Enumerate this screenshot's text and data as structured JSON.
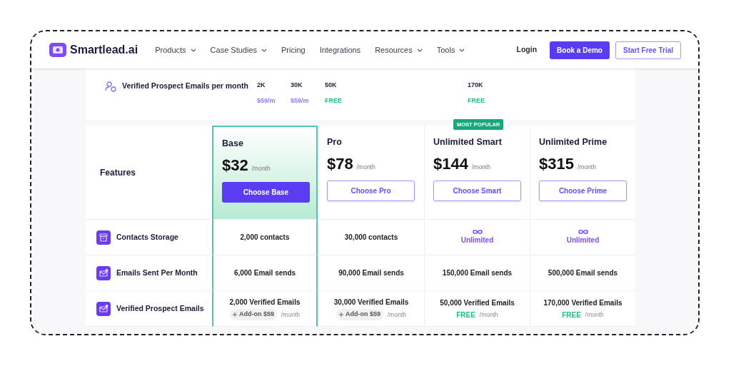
{
  "brand": {
    "name": "Smartlead.ai"
  },
  "nav": [
    {
      "label": "Products",
      "has_menu": true
    },
    {
      "label": "Case Studies",
      "has_menu": true
    },
    {
      "label": "Pricing",
      "has_menu": false
    },
    {
      "label": "Integrations",
      "has_menu": false
    },
    {
      "label": "Resources",
      "has_menu": true
    },
    {
      "label": "Tools",
      "has_menu": true
    }
  ],
  "nav_actions": [
    {
      "label": "Login",
      "kind": "link"
    },
    {
      "label": "Book a Demo",
      "kind": "primary"
    },
    {
      "label": "Start Free Trial",
      "kind": "outline"
    }
  ],
  "prospect_row": {
    "label": "Verified Prospect Emails per month",
    "values": [
      {
        "amount": "2K",
        "price": "$59/m",
        "kind": "paid"
      },
      {
        "amount": "30K",
        "price": "$59/m",
        "kind": "paid"
      },
      {
        "amount": "50K",
        "price": "FREE",
        "kind": "free"
      },
      {
        "amount": "170K",
        "price": "FREE",
        "kind": "free"
      }
    ]
  },
  "table": {
    "features_heading": "Features",
    "plans": [
      {
        "name": "Base",
        "price": "$32",
        "period": "/month",
        "button": "Choose Base",
        "selected": true
      },
      {
        "name": "Pro",
        "price": "$78",
        "period": "/month",
        "button": "Choose Pro",
        "selected": false
      },
      {
        "name": "Unlimited Smart",
        "price": "$144",
        "period": "/month",
        "button": "Choose Smart",
        "selected": false,
        "badge": "MOST POPULAR"
      },
      {
        "name": "Unlimited Prime",
        "price": "$315",
        "period": "/month",
        "button": "Choose Prime",
        "selected": false
      }
    ],
    "rows": [
      {
        "feature": "Contacts Storage",
        "cells": [
          {
            "kind": "plain",
            "text": "2,000 contacts"
          },
          {
            "kind": "plain",
            "text": "30,000 contacts"
          },
          {
            "kind": "unlimited",
            "text": "Unlimited"
          },
          {
            "kind": "unlimited",
            "text": "Unlimited"
          }
        ]
      },
      {
        "feature": "Emails Sent Per Month",
        "cells": [
          {
            "kind": "plain",
            "text": "6,000 Email sends"
          },
          {
            "kind": "plain",
            "text": "90,000 Email sends"
          },
          {
            "kind": "plain",
            "text": "150,000 Email sends"
          },
          {
            "kind": "plain",
            "text": "500,000 Email sends"
          }
        ]
      },
      {
        "feature": "Verified Prospect Emails",
        "cells": [
          {
            "kind": "addon",
            "text": "2,000 Verified Emails",
            "note": "Add-on $59",
            "period": "/month"
          },
          {
            "kind": "addon",
            "text": "30,000 Verified Emails",
            "note": "Add-on $59",
            "period": "/month"
          },
          {
            "kind": "free",
            "text": "50,000 Verified Emails",
            "note": "FREE",
            "period": "/month"
          },
          {
            "kind": "free",
            "text": "170,000 Verified Emails",
            "note": "FREE",
            "period": "/month"
          }
        ]
      }
    ]
  }
}
